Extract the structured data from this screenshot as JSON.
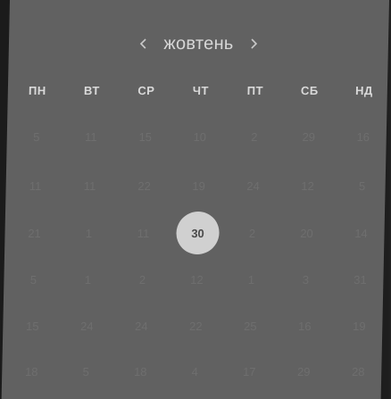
{
  "calendar": {
    "month_label": "жовтень",
    "prev_icon": "chevron-left-icon",
    "next_icon": "chevron-right-icon",
    "weekdays": [
      "ПН",
      "ВТ",
      "СР",
      "ЧТ",
      "ПТ",
      "СБ",
      "НД"
    ],
    "weeks": [
      [
        "5",
        "11",
        "15",
        "10",
        "2",
        "29",
        "16"
      ],
      [
        "11",
        "11",
        "22",
        "19",
        "24",
        "12",
        "5"
      ],
      [
        "21",
        "1",
        "11",
        "30",
        "2",
        "20",
        "14"
      ],
      [
        "5",
        "1",
        "2",
        "12",
        "1",
        "3",
        "31"
      ],
      [
        "15",
        "24",
        "24",
        "22",
        "25",
        "16",
        "19"
      ],
      [
        "18",
        "5",
        "18",
        "4",
        "17",
        "29",
        "28"
      ]
    ],
    "selected_day": "30",
    "colors": {
      "background": "#616161",
      "day_text": "#6e6e6e",
      "selected_fill": "#d0d0d0",
      "selected_text": "#4a4a4a",
      "header_text": "#d6d6d6"
    }
  }
}
